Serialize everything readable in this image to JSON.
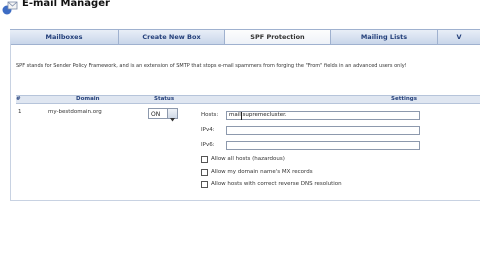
{
  "app": {
    "title": "E-mail Manager"
  },
  "tabs": [
    {
      "label": "Mailboxes",
      "active": false
    },
    {
      "label": "Create New Box",
      "active": false
    },
    {
      "label": "SPF Protection",
      "active": true
    },
    {
      "label": "Mailing Lists",
      "active": false
    },
    {
      "label": "V",
      "active": false
    }
  ],
  "description": "SPF stands for Sender Policy Framework, and is an extension of SMTP that stops e-mail spammers from forging the \"From\" fields in an advanced users only!",
  "table": {
    "headers": {
      "num": "#",
      "domain": "Domain",
      "status": "Status",
      "settings": "Settings"
    },
    "row": {
      "num": "1",
      "domain": "my-bestdomain.org",
      "status": "ON",
      "settings": {
        "hosts_label": "Hosts:",
        "hosts_value": "mail.supremecluster.",
        "ipv4_label": "IPv4:",
        "ipv4_value": "",
        "ipv6_label": "IPv6:",
        "ipv6_value": "",
        "options": [
          {
            "label": "Allow all hosts (hazardous)",
            "checked": false
          },
          {
            "label": "Allow my domain name's MX records",
            "checked": false
          },
          {
            "label": "Allow hosts with correct reverse DNS resolution",
            "checked": false
          }
        ]
      }
    }
  },
  "colors": {
    "accent": "#233f7a",
    "tab_bar": "#c9d6ea",
    "header_row": "#dfe6f1"
  }
}
